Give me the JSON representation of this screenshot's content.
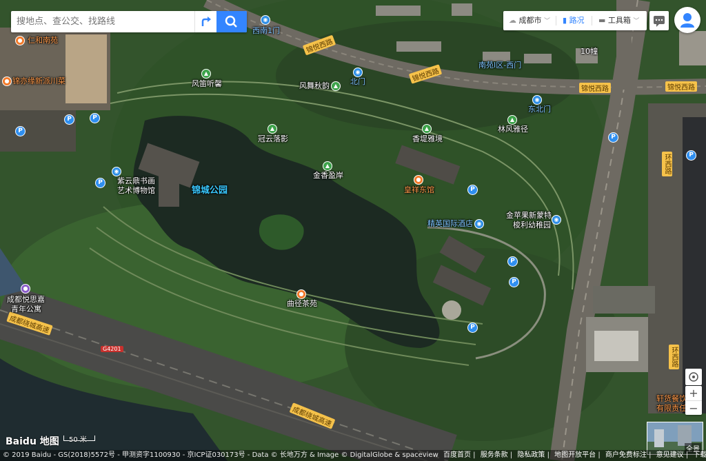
{
  "search": {
    "placeholder": "搜地点、查公交、找路线"
  },
  "toolbar": {
    "city": "成都市",
    "traffic": "路况",
    "tools": "工具箱"
  },
  "pois": {
    "renhe": "仁和南苑",
    "jinyiyuan": "锦亦缘新派川菜",
    "xinan_gate": "西南1门",
    "fengdi": "风笛听馨",
    "fengwu": "风舞秋韵",
    "beimen": "北门",
    "nanyuan": "南苑I区-西门",
    "building10": "10幢",
    "dongbeimen": "东北门",
    "linfeng": "林风雅径",
    "guanyun": "冠云落影",
    "xiangdi": "香堤雅境",
    "jinxiang": "金香盈岸",
    "zixin_1": "紫云鼎书画",
    "zixin_2": "艺术博物馆",
    "park": "锦城公园",
    "huangxiang": "皇祥东馆",
    "jinping_1": "金苹果新蒙特",
    "jinping_2": "梭利幼稚园",
    "hotel": "精英国际酒店",
    "quzhu": "曲径茶苑",
    "yuesi_1": "成都悦思嘉",
    "yuesi_2": "青年公寓",
    "xuanhuo_1": "轩货餐饮",
    "xuanhuo_2": "有限责任"
  },
  "roads": {
    "jinyue_w": "锦悦西路",
    "jinyue_w2": "锦悦西路",
    "jinyue_w3": "锦悦西路",
    "jinyue_w4": "锦悦西路",
    "ring_road": "成都绕城高速",
    "ring_road2": "成都绕城高速",
    "g4201": "G4201",
    "huanxi": "环西路",
    "huanxi2": "环西路"
  },
  "scale": "50 米",
  "logo": "Baidu 地图",
  "overview_label": "全景",
  "copyright": "© 2019 Baidu - GS(2018)5572号 - 甲测资字1100930 - 京ICP证030173号 - Data © 长地万方 & Image © DigitalGlobe & spaceview",
  "footer_links": [
    "百度首页",
    "服务条款",
    "隐私政策",
    "地图开放平台",
    "商户免费标注",
    "意见建议",
    "下载地图客户端"
  ]
}
